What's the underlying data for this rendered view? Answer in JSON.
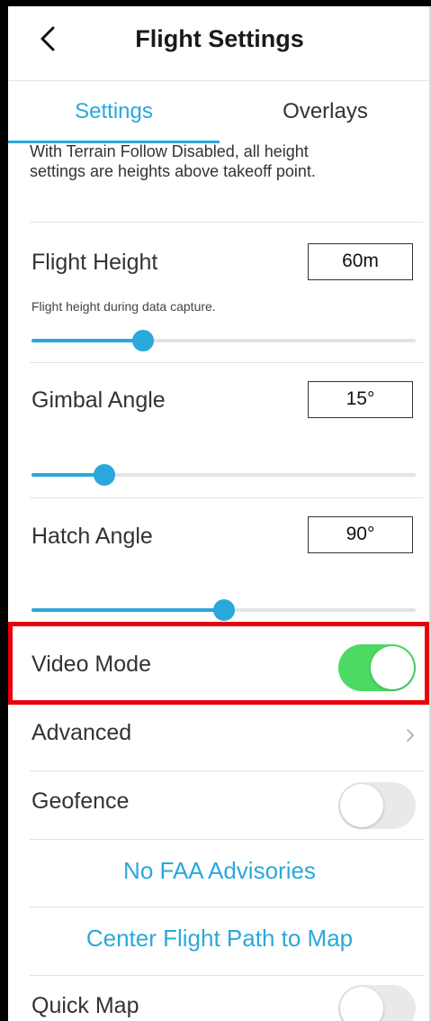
{
  "header": {
    "title": "Flight Settings",
    "back_icon": "chevron-left-icon"
  },
  "tabs": [
    {
      "label": "Settings",
      "active": true
    },
    {
      "label": "Overlays",
      "active": false
    }
  ],
  "info_text": "With Terrain Follow Disabled, all height settings are heights above takeoff point.",
  "flight_height": {
    "label": "Flight Height",
    "value": "60m",
    "help": "Flight height during data capture.",
    "slider_fraction": 0.29
  },
  "gimbal_angle": {
    "label": "Gimbal Angle",
    "value": "15°",
    "slider_fraction": 0.19
  },
  "hatch_angle": {
    "label": "Hatch Angle",
    "value": "90°",
    "slider_fraction": 0.5
  },
  "video_mode": {
    "label": "Video Mode",
    "on": true
  },
  "advanced": {
    "label": "Advanced",
    "icon": "chevron-right-icon"
  },
  "geofence": {
    "label": "Geofence",
    "on": false
  },
  "faa_link": "No FAA Advisories",
  "center_link": "Center Flight Path to Map",
  "quick_map": {
    "label": "Quick Map",
    "on": false
  },
  "colors": {
    "accent": "#2aa8dc",
    "toggle_on": "#4cd964",
    "highlight": "#e8000b"
  }
}
